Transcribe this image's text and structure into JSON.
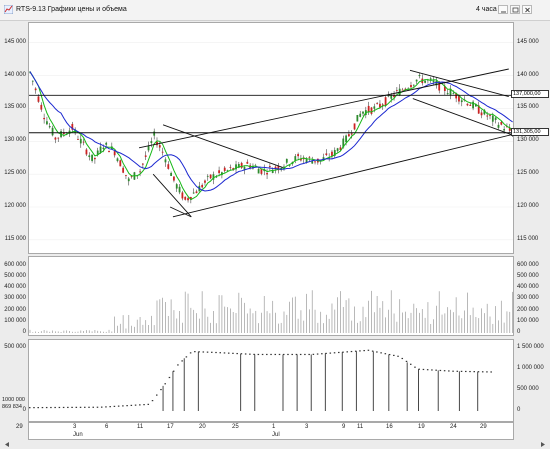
{
  "window": {
    "title": "RTS-9.13 Графики цены и объема",
    "period": "4 часа"
  },
  "price_tags": [
    "137,000,00",
    "131,305,00"
  ],
  "oi_tag": "869 834",
  "colors": {
    "up": "#2e8b2e",
    "down": "#cc2222",
    "ma_fast": "#17b817",
    "ma_slow": "#1c28d0",
    "bar": "#9a9a9a",
    "oi": "#333333"
  },
  "chart_data": [
    {
      "type": "candlestick",
      "ylim": [
        113000,
        148000
      ],
      "yticks": [
        "145 000",
        "140 000",
        "135 000",
        "130 000",
        "125 000",
        "120 000",
        "115 000"
      ],
      "ytick_values": [
        145000,
        140000,
        135000,
        130000,
        125000,
        120000,
        115000
      ],
      "ma_fast_color": "#17b817",
      "ma_slow_color": "#1c28d0"
    },
    {
      "type": "bar",
      "ylim": [
        0,
        640000
      ],
      "yticks": [
        "600 000",
        "500 000",
        "400 000",
        "300 000",
        "200 000",
        "100 000",
        "0"
      ],
      "ytick_values": [
        600000,
        500000,
        400000,
        300000,
        200000,
        100000,
        0
      ]
    },
    {
      "type": "line",
      "left_yticks": [
        "500 000",
        "0"
      ],
      "left_ytick_values": [
        500000,
        0
      ],
      "right_yticks": [
        "1 500 000",
        "1 000 000",
        "500 000",
        "0"
      ],
      "right_ytick_values": [
        1500000,
        1000000,
        500000,
        0
      ],
      "left_partial": "1000 000"
    }
  ],
  "x_axis": {
    "days": [
      "29",
      "3",
      "6",
      "11",
      "17",
      "20",
      "25",
      "1",
      "3",
      "9",
      "11",
      "16",
      "19",
      "24",
      "29"
    ],
    "months": [
      "Jun",
      "Jul"
    ]
  }
}
